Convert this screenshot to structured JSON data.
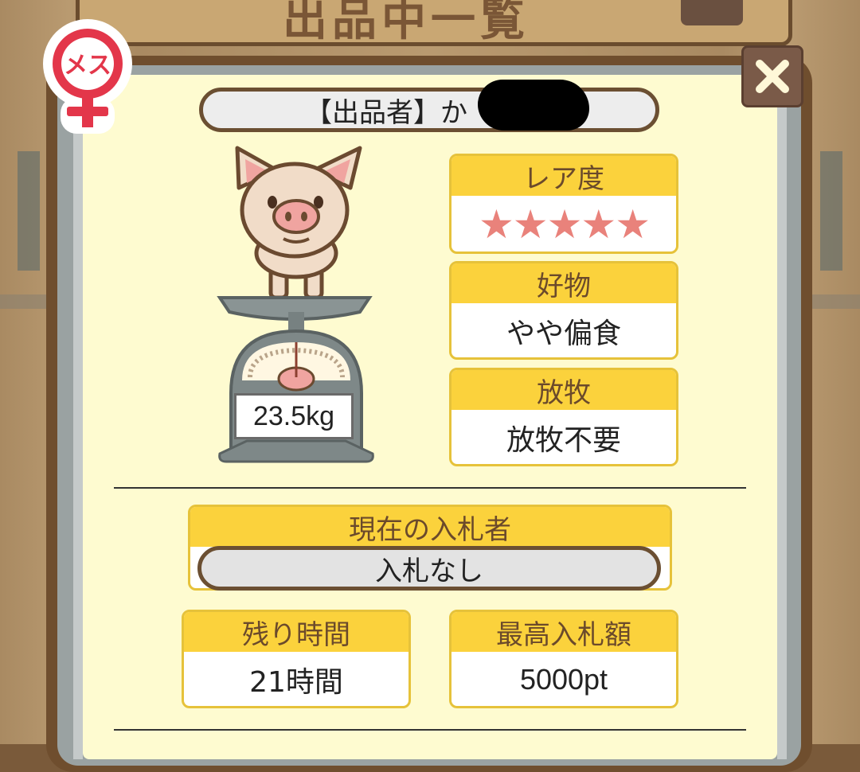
{
  "background": {
    "title": "出品中一覧"
  },
  "badge": {
    "label": "メス"
  },
  "close_icon": "close-icon",
  "seller": {
    "label": "【出品者】",
    "name_visible": "か"
  },
  "pig": {
    "weight": "23.5kg"
  },
  "rarity": {
    "title": "レア度",
    "stars": "★★★★★",
    "value": 5,
    "max": 5
  },
  "preference": {
    "title": "好物",
    "value": "やや偏食"
  },
  "grazing": {
    "title": "放牧",
    "value": "放牧不要"
  },
  "bidder": {
    "title": "現在の入札者",
    "value": "入札なし"
  },
  "remaining": {
    "title": "残り時間",
    "value": "21時間"
  },
  "highest_bid": {
    "title": "最高入札額",
    "value": "5000pt"
  },
  "colors": {
    "card_header": "#fbd23c",
    "panel": "#fefbd0",
    "frame": "#6f4e2e",
    "star": "#e9827b",
    "badge": "#e3364a"
  }
}
